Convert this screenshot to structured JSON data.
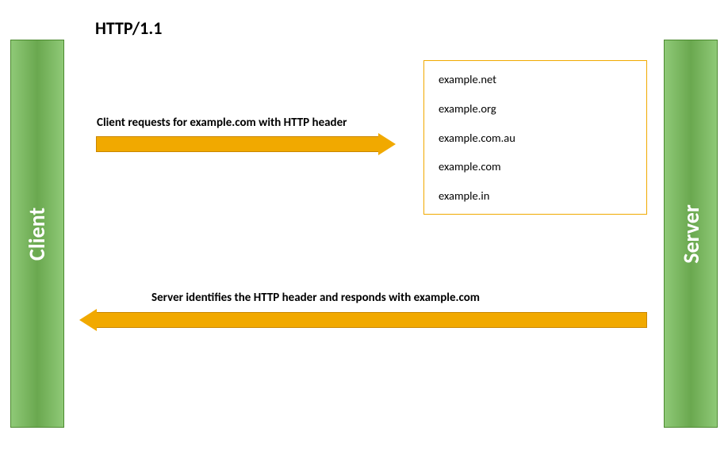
{
  "title": "HTTP/1.1",
  "client_label": "Client",
  "server_label": "Server",
  "request_text": "Client requests for example.com with HTTP header",
  "response_text": "Server identifies the HTTP header and responds with example.com",
  "hosts": {
    "h0": "example.net",
    "h1": "example.org",
    "h2": "example.com.au",
    "h3": "example.com",
    "h4": "example.in"
  },
  "colors": {
    "pillar_green": "#6aa84f",
    "arrow_orange": "#f1a900"
  }
}
